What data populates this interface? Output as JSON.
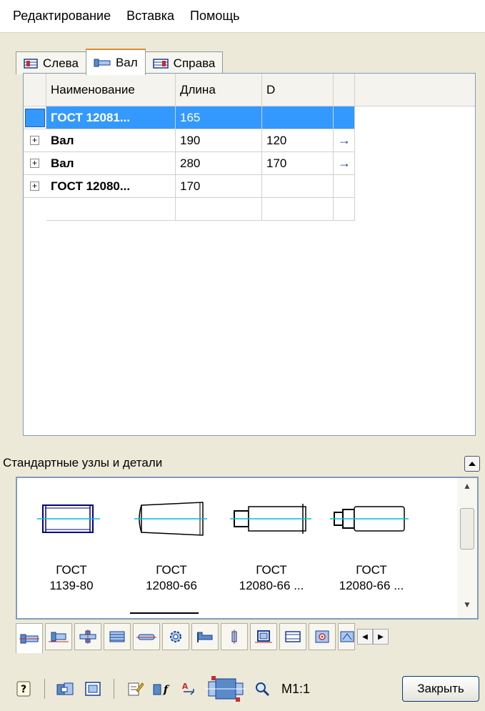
{
  "menu": [
    "Редактирование",
    "Вставка",
    "Помощь"
  ],
  "tabs": [
    {
      "label": "Слева",
      "icon": "left-assembly-icon",
      "active": false
    },
    {
      "label": "Вал",
      "icon": "shaft-icon",
      "active": true
    },
    {
      "label": "Справа",
      "icon": "right-assembly-icon",
      "active": false
    }
  ],
  "grid": {
    "columns": [
      "Наименование",
      "Длина",
      "D"
    ],
    "rows": [
      {
        "name": "ГОСТ 12081...",
        "length": "165",
        "d": "",
        "arrow": "",
        "expandable": false,
        "selected": true
      },
      {
        "name": "Вал",
        "length": "190",
        "d": "120",
        "arrow": "→",
        "expandable": true,
        "selected": false
      },
      {
        "name": "Вал",
        "length": "280",
        "d": "170",
        "arrow": "→",
        "expandable": true,
        "selected": false
      },
      {
        "name": "ГОСТ 12080...",
        "length": "170",
        "d": "",
        "arrow": "",
        "expandable": true,
        "selected": false
      },
      {
        "name": "",
        "length": "",
        "d": "",
        "arrow": "",
        "expandable": false,
        "selected": false
      }
    ]
  },
  "library": {
    "label": "Стандартные узлы и детали",
    "items": [
      {
        "line1": "ГОСТ",
        "line2": "1139-80"
      },
      {
        "line1": "ГОСТ",
        "line2": "12080-66"
      },
      {
        "line1": "ГОСТ",
        "line2": "12080-66 ..."
      },
      {
        "line1": "ГОСТ",
        "line2": "12080-66 ..."
      }
    ]
  },
  "category_tabs": [
    "shaft-icon",
    "bushing-icon",
    "flange-icon",
    "spline-icon",
    "key-icon",
    "gear-icon",
    "step-icon",
    "thread-icon",
    "ring-icon",
    "sleeve-icon",
    "center-icon",
    "groove-icon"
  ],
  "toolbar": {
    "scale": "M1:1",
    "close_label": "Закрыть"
  },
  "colors": {
    "selection": "#3399ff",
    "window_bg": "#ECE9D8",
    "grid_border": "#7f9db9",
    "axis_line": "#00c0d8",
    "shaft_outline": "#000080"
  }
}
